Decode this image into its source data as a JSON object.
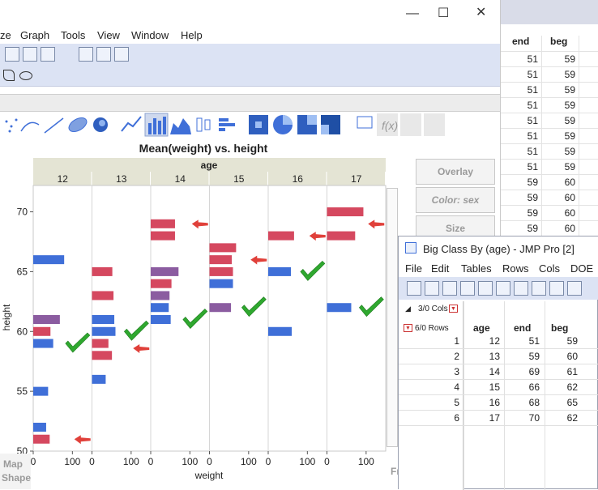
{
  "window": {
    "title_fragment": "",
    "menus": [
      "ze",
      "Graph",
      "Tools",
      "View",
      "Window",
      "Help"
    ]
  },
  "side_panel": {
    "overlay": "Overlay",
    "color": "Color: sex",
    "size": "Size"
  },
  "bottom_left": {
    "map": "Map",
    "shape": "Shape",
    "fr": "Fr"
  },
  "background_table": {
    "headers": [
      "end",
      "beg"
    ],
    "rows": [
      [
        "51",
        "59"
      ],
      [
        "51",
        "59"
      ],
      [
        "51",
        "59"
      ],
      [
        "51",
        "59"
      ],
      [
        "51",
        "59"
      ],
      [
        "51",
        "59"
      ],
      [
        "51",
        "59"
      ],
      [
        "51",
        "59"
      ],
      [
        "59",
        "60"
      ],
      [
        "59",
        "60"
      ],
      [
        "59",
        "60"
      ],
      [
        "59",
        "60"
      ]
    ]
  },
  "popup": {
    "title": "Big Class By (age) - JMP Pro [2]",
    "menus": [
      "File",
      "Edit",
      "Tables",
      "Rows",
      "Cols",
      "DOE"
    ],
    "cols_label": "3/0 Cols",
    "rows_label": "6/0 Rows",
    "headers": [
      "age",
      "end",
      "beg"
    ],
    "rows": [
      [
        "1",
        "12",
        "51",
        "59"
      ],
      [
        "2",
        "13",
        "59",
        "60"
      ],
      [
        "3",
        "14",
        "69",
        "61"
      ],
      [
        "4",
        "15",
        "66",
        "62"
      ],
      [
        "5",
        "16",
        "68",
        "65"
      ],
      [
        "6",
        "17",
        "70",
        "62"
      ]
    ]
  },
  "chart_data": {
    "type": "bar",
    "title": "Mean(weight) vs. height",
    "group_label": "age",
    "panels": [
      "12",
      "13",
      "14",
      "15",
      "16",
      "17"
    ],
    "xlabel": "weight",
    "ylabel": "height",
    "ylim": [
      50,
      72
    ],
    "xlim": [
      0,
      150
    ],
    "x_ticks": [
      "0",
      "100"
    ],
    "y_ticks": [
      "50",
      "55",
      "60",
      "65",
      "70"
    ],
    "colors": {
      "blue": "#3f6fd8",
      "red": "#d5485f",
      "purple": "#8b5ca0",
      "check": "#2fa82f",
      "arrow": "#e0403a"
    },
    "bars": [
      {
        "panel": "12",
        "y": 66,
        "value": 79,
        "color": "blue"
      },
      {
        "panel": "12",
        "y": 61,
        "value": 68,
        "color": "purple"
      },
      {
        "panel": "12",
        "y": 60,
        "value": 44,
        "color": "red"
      },
      {
        "panel": "12",
        "y": 59,
        "value": 51,
        "color": "blue"
      },
      {
        "panel": "12",
        "y": 55,
        "value": 38,
        "color": "blue"
      },
      {
        "panel": "12",
        "y": 52,
        "value": 33,
        "color": "blue"
      },
      {
        "panel": "12",
        "y": 51,
        "value": 42,
        "color": "red"
      },
      {
        "panel": "13",
        "y": 65,
        "value": 52,
        "color": "red"
      },
      {
        "panel": "13",
        "y": 63,
        "value": 55,
        "color": "red"
      },
      {
        "panel": "13",
        "y": 61,
        "value": 57,
        "color": "blue"
      },
      {
        "panel": "13",
        "y": 60,
        "value": 60,
        "color": "blue"
      },
      {
        "panel": "13",
        "y": 59,
        "value": 42,
        "color": "red"
      },
      {
        "panel": "13",
        "y": 58,
        "value": 51,
        "color": "red"
      },
      {
        "panel": "13",
        "y": 56,
        "value": 35,
        "color": "blue"
      },
      {
        "panel": "14",
        "y": 69,
        "value": 62,
        "color": "red"
      },
      {
        "panel": "14",
        "y": 68,
        "value": 62,
        "color": "red"
      },
      {
        "panel": "14",
        "y": 65,
        "value": 71,
        "color": "purple"
      },
      {
        "panel": "14",
        "y": 64,
        "value": 53,
        "color": "red"
      },
      {
        "panel": "14",
        "y": 63,
        "value": 48,
        "color": "purple"
      },
      {
        "panel": "14",
        "y": 62,
        "value": 46,
        "color": "blue"
      },
      {
        "panel": "14",
        "y": 61,
        "value": 51,
        "color": "blue"
      },
      {
        "panel": "15",
        "y": 67,
        "value": 68,
        "color": "red"
      },
      {
        "panel": "15",
        "y": 66,
        "value": 57,
        "color": "red"
      },
      {
        "panel": "15",
        "y": 65,
        "value": 60,
        "color": "red"
      },
      {
        "panel": "15",
        "y": 64,
        "value": 60,
        "color": "blue"
      },
      {
        "panel": "15",
        "y": 62,
        "value": 55,
        "color": "purple"
      },
      {
        "panel": "16",
        "y": 68,
        "value": 66,
        "color": "red"
      },
      {
        "panel": "16",
        "y": 65,
        "value": 58,
        "color": "blue"
      },
      {
        "panel": "16",
        "y": 60,
        "value": 60,
        "color": "blue"
      },
      {
        "panel": "17",
        "y": 70,
        "value": 93,
        "color": "red"
      },
      {
        "panel": "17",
        "y": 68,
        "value": 72,
        "color": "red"
      },
      {
        "panel": "17",
        "y": 62,
        "value": 62,
        "color": "blue"
      }
    ],
    "checks": [
      {
        "panel": "12",
        "y": 59
      },
      {
        "panel": "13",
        "y": 60
      },
      {
        "panel": "14",
        "y": 61
      },
      {
        "panel": "15",
        "y": 62
      },
      {
        "panel": "16",
        "y": 65
      },
      {
        "panel": "17",
        "y": 62
      }
    ],
    "arrows": [
      {
        "panel": "12",
        "y": 51
      },
      {
        "panel": "13",
        "y": 58.6
      },
      {
        "panel": "14",
        "y": 69
      },
      {
        "panel": "15",
        "y": 66
      },
      {
        "panel": "16",
        "y": 68
      },
      {
        "panel": "17",
        "y": 69
      }
    ]
  }
}
